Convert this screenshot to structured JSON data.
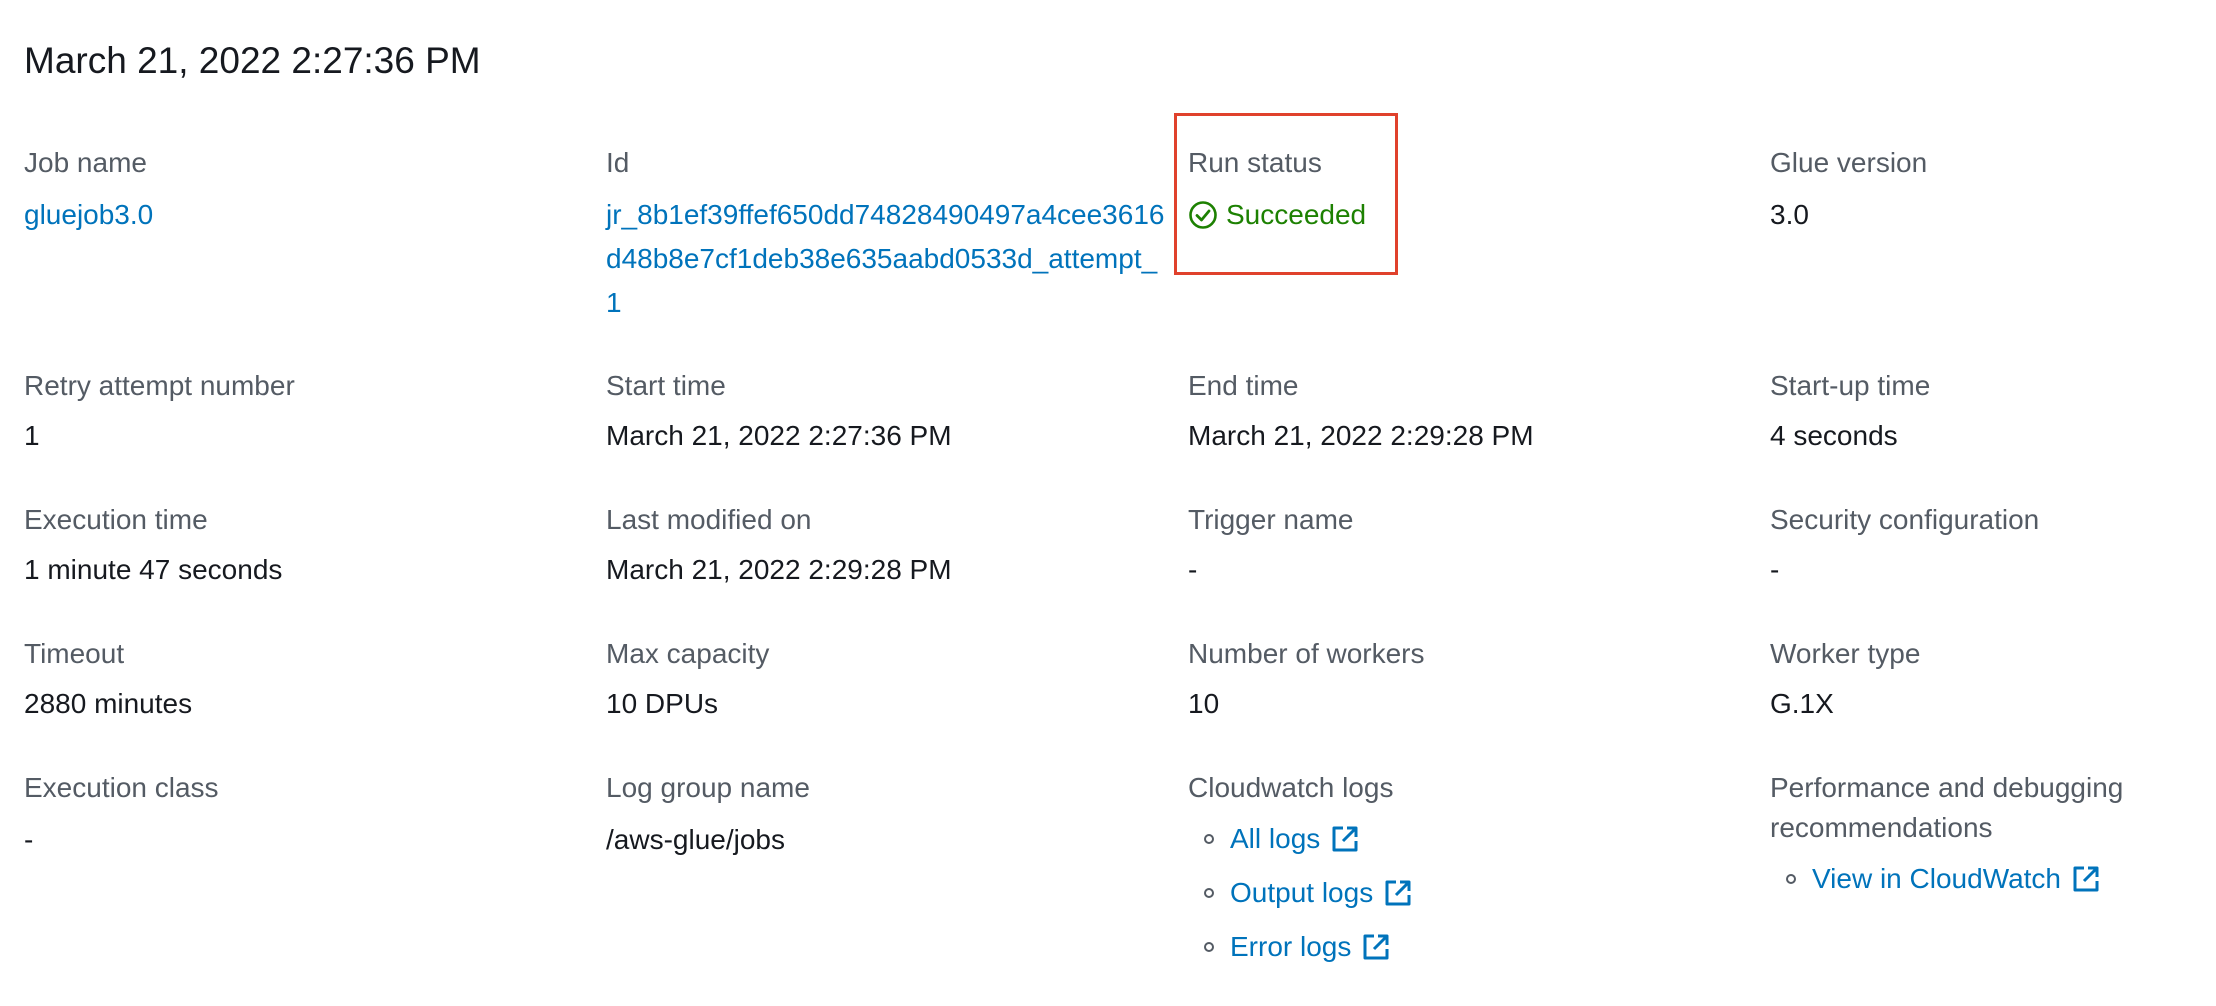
{
  "header": {
    "title": "March 21, 2022 2:27:36 PM"
  },
  "fields": {
    "job_name": {
      "label": "Job name",
      "value": "gluejob3.0"
    },
    "id": {
      "label": "Id",
      "value": "jr_8b1ef39ffef650dd74828490497a4cee3616d48b8e7cf1deb38e635aabd0533d_attempt_1"
    },
    "run_status": {
      "label": "Run status",
      "value": "Succeeded"
    },
    "glue_version": {
      "label": "Glue version",
      "value": "3.0"
    },
    "retry_attempt": {
      "label": "Retry attempt number",
      "value": "1"
    },
    "start_time": {
      "label": "Start time",
      "value": "March 21, 2022 2:27:36 PM"
    },
    "end_time": {
      "label": "End time",
      "value": "March 21, 2022 2:29:28 PM"
    },
    "startup_time": {
      "label": "Start-up time",
      "value": "4 seconds"
    },
    "execution_time": {
      "label": "Execution time",
      "value": "1 minute 47 seconds"
    },
    "last_modified": {
      "label": "Last modified on",
      "value": "March 21, 2022 2:29:28 PM"
    },
    "trigger_name": {
      "label": "Trigger name",
      "value": "-"
    },
    "security_config": {
      "label": "Security configuration",
      "value": "-"
    },
    "timeout": {
      "label": "Timeout",
      "value": "2880 minutes"
    },
    "max_capacity": {
      "label": "Max capacity",
      "value": "10 DPUs"
    },
    "num_workers": {
      "label": "Number of workers",
      "value": "10"
    },
    "worker_type": {
      "label": "Worker type",
      "value": "G.1X"
    },
    "execution_class": {
      "label": "Execution class",
      "value": "-"
    },
    "log_group": {
      "label": "Log group name",
      "value": "/aws-glue/jobs"
    },
    "cloudwatch_logs": {
      "label": "Cloudwatch logs",
      "links": [
        "All logs",
        "Output logs",
        "Error logs"
      ]
    },
    "performance": {
      "label_line1": "Performance and debugging",
      "label_line2": "recommendations",
      "links": [
        "View in CloudWatch"
      ]
    }
  },
  "colors": {
    "link": "#0073bb",
    "success": "#1d8102",
    "label": "#545b64",
    "text": "#16191f",
    "highlight": "#e0412c"
  },
  "icons": {
    "status": "check-circle-icon",
    "external": "external-link-icon"
  }
}
